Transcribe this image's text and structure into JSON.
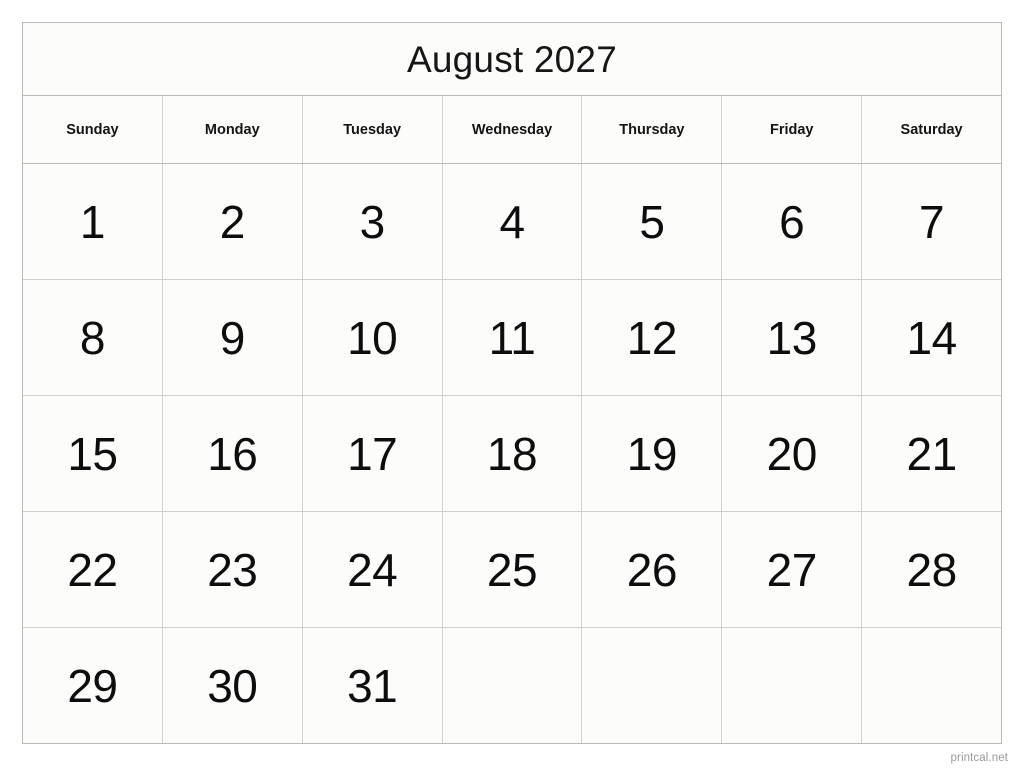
{
  "calendar": {
    "title": "August 2027",
    "month": "August",
    "year": "2027",
    "weekday_headers": [
      "Sunday",
      "Monday",
      "Tuesday",
      "Wednesday",
      "Thursday",
      "Friday",
      "Saturday"
    ],
    "weeks": [
      [
        "1",
        "2",
        "3",
        "4",
        "5",
        "6",
        "7"
      ],
      [
        "8",
        "9",
        "10",
        "11",
        "12",
        "13",
        "14"
      ],
      [
        "15",
        "16",
        "17",
        "18",
        "19",
        "20",
        "21"
      ],
      [
        "22",
        "23",
        "24",
        "25",
        "26",
        "27",
        "28"
      ],
      [
        "29",
        "30",
        "31",
        "",
        "",
        "",
        ""
      ]
    ],
    "colors": {
      "page_background": "#ffffff",
      "cell_background": "#fcfdfa",
      "outer_border": "#b9bbb7",
      "inner_border": "#cfd1cd",
      "text": "#0d0d0d",
      "watermark": "#9a9a9a"
    }
  },
  "watermark": {
    "text": "printcal.net"
  }
}
